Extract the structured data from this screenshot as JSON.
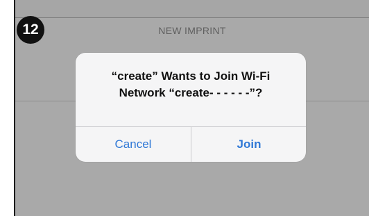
{
  "step": {
    "number": "12"
  },
  "screen": {
    "title": "NEW IMPRINT"
  },
  "dialog": {
    "message_line1": "“create” Wants to Join Wi-Fi",
    "message_line2": "Network “create- - - - - -”?",
    "cancel_label": "Cancel",
    "join_label": "Join"
  },
  "colors": {
    "accent": "#2f78d6",
    "background": "#a9a9a9",
    "dialog": "#f5f5f6"
  }
}
